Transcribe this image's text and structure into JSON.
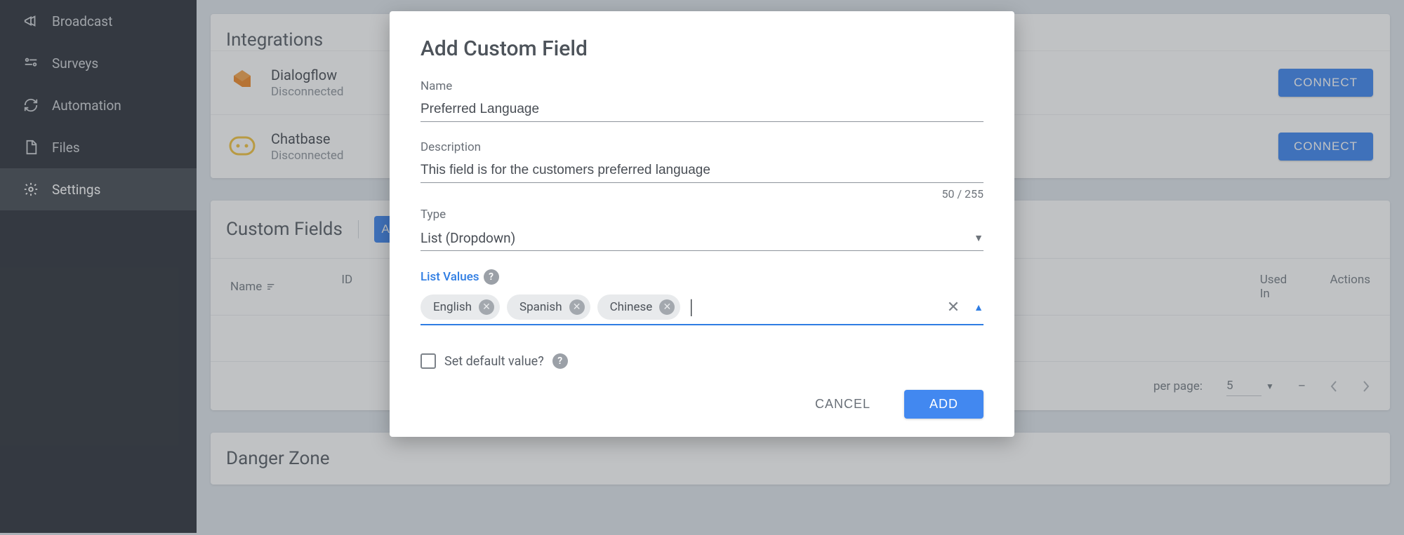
{
  "sidebar": {
    "items": [
      {
        "label": "Broadcast"
      },
      {
        "label": "Surveys"
      },
      {
        "label": "Automation"
      },
      {
        "label": "Files"
      },
      {
        "label": "Settings"
      }
    ]
  },
  "integrations": {
    "title": "Integrations",
    "rows": [
      {
        "name": "Dialogflow",
        "status": "Disconnected",
        "action": "CONNECT"
      },
      {
        "name": "Chatbase",
        "status": "Disconnected",
        "action": "CONNECT"
      }
    ]
  },
  "customFields": {
    "title": "Custom Fields",
    "addLabel": "ADD",
    "columns": {
      "name": "Name",
      "id": "ID",
      "usedIn": "Used In",
      "actions": "Actions"
    },
    "pager": {
      "rowsPerPageLabel": "per page:",
      "rowsPerPageValue": "5",
      "range": "–"
    }
  },
  "dangerZone": {
    "title": "Danger Zone"
  },
  "modal": {
    "title": "Add Custom Field",
    "nameLabel": "Name",
    "nameValue": "Preferred Language",
    "descLabel": "Description",
    "descValue": "This field is for the customers preferred language",
    "descCounter": "50 / 255",
    "typeLabel": "Type",
    "typeValue": "List (Dropdown)",
    "listValuesLabel": "List Values",
    "chips": [
      "English",
      "Spanish",
      "Chinese"
    ],
    "defaultLabel": "Set default value?",
    "cancelLabel": "CANCEL",
    "addLabel": "ADD"
  }
}
